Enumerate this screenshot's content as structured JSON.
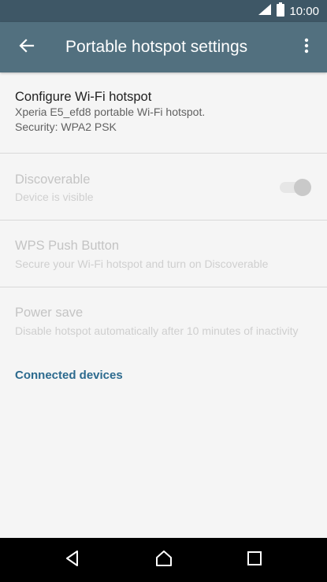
{
  "status_bar": {
    "time": "10:00",
    "icons": [
      "signal-icon",
      "battery-icon"
    ]
  },
  "app_bar": {
    "title": "Portable hotspot settings",
    "back_icon": "arrow-back-icon",
    "menu_icon": "more-vert-icon"
  },
  "settings": {
    "configure": {
      "title": "Configure Wi-Fi hotspot",
      "line1": "Xperia E5_efd8 portable Wi-Fi hotspot.",
      "line2": "Security: WPA2 PSK"
    },
    "discoverable": {
      "title": "Discoverable",
      "subtitle": "Device is visible",
      "enabled": false,
      "toggle_on": true
    },
    "wps": {
      "title": "WPS Push Button",
      "subtitle": "Secure your Wi-Fi hotspot and turn on Discoverable",
      "enabled": false
    },
    "power_save": {
      "title": "Power save",
      "subtitle": "Disable hotspot automatically after 10 minutes of inactivity",
      "enabled": false
    }
  },
  "section": {
    "connected_devices": "Connected devices"
  },
  "nav_bar": {
    "buttons": [
      "back-icon",
      "home-icon",
      "recents-icon"
    ]
  },
  "colors": {
    "status_bar": "#3e5766",
    "app_bar": "#52707f",
    "accent": "#2c6a8e",
    "background": "#f5f5f5"
  }
}
